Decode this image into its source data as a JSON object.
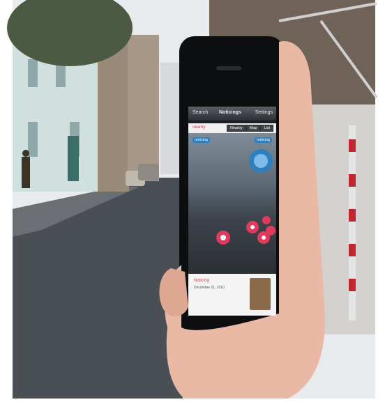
{
  "phone": {
    "header": {
      "left": "Search",
      "title": "Noticings",
      "right": "Settings"
    },
    "subbar": {
      "label": "nearby",
      "tabs": [
        "Nearby",
        "Map",
        "List"
      ]
    },
    "tags": [
      "noticing",
      "noticing"
    ],
    "card": {
      "title": "Noticing",
      "subtitle": "December 21, 2010",
      "thumb": "avatar-photo"
    }
  },
  "colors": {
    "accent": "#d13a48",
    "blue": "#2f7fbf"
  }
}
